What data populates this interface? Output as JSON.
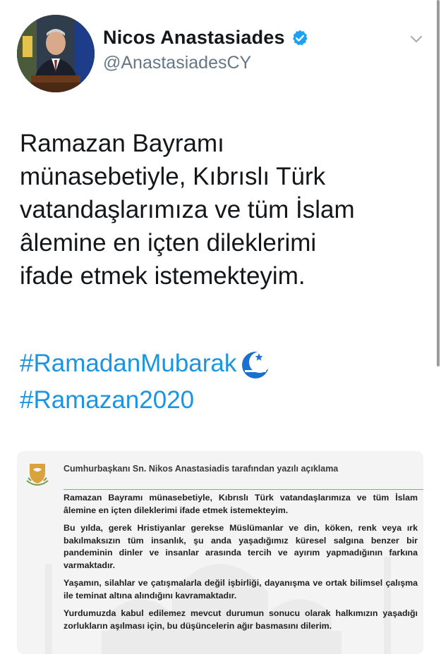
{
  "profile": {
    "display_name": "Nicos Anastasiades",
    "handle": "@AnastasiadesCY",
    "verified_icon": "verified-badge-icon",
    "avatar_icon": "profile-photo"
  },
  "tweet": {
    "lines": [
      "Ramazan Bayramı",
      "münasebetiyle, Kıbrıslı Türk",
      "vatandaşlarımıza ve tüm İslam",
      "âlemine en içten dileklerimi",
      "ifade etmek istemekteyim."
    ],
    "hashtags": [
      "#RamadanMubarak",
      "#Ramazan2020"
    ],
    "emoji_icon": "crescent-moon-icon"
  },
  "image_card": {
    "title": "Cumhurbaşkanı Sn. Nikos Anastasiadis tarafından yazılı açıklama",
    "paragraphs": [
      "Ramazan Bayramı münasebetiyle, Kıbrıslı Türk vatandaşlarımıza ve tüm İslam âlemine en içten dileklerimi ifade etmek istemekteyim.",
      "Bu yılda, gerek Hristiyanlar gerekse Müslümanlar ve din, köken, renk veya ırk bakılmaksızın tüm insanlık, şu anda yaşadığımız küresel salgına benzer bir pandeminin dinler ve insanlar arasında tercih ve ayırım yapmadığının farkına varmaktadır.",
      "Yaşamın, silahlar ve çatışmalarla değil işbirliği, dayanışma ve ortak bilimsel çalışma ile teminat altına alındığını kavramaktadır.",
      "Yurdumuzda kabul edilemez mevcut durumun sonucu olarak halkımızın yaşadığı zorlukların aşılması için, bu düşüncelerin ağır basmasını dilerim."
    ],
    "colors": {
      "rule": "#e08a2c",
      "emblem": "#d9a23a"
    }
  },
  "colors": {
    "link": "#1b95e0",
    "verified": "#1da1f2",
    "handle": "#657786"
  }
}
